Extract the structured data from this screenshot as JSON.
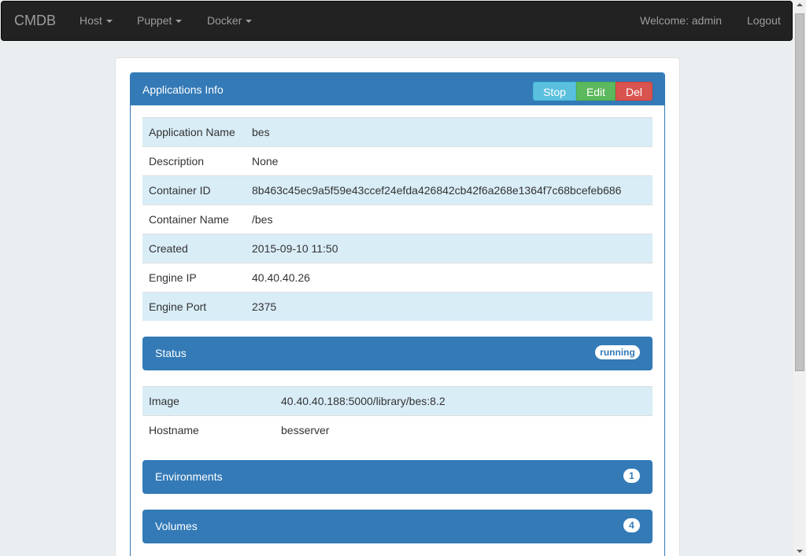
{
  "nav": {
    "brand": "CMDB",
    "menus": [
      "Host",
      "Puppet",
      "Docker"
    ],
    "welcome": "Welcome: admin",
    "logout": "Logout"
  },
  "panel": {
    "title": "Applications Info",
    "buttons": {
      "stop": "Stop",
      "edit": "Edit",
      "del": "Del"
    },
    "rows": [
      {
        "label": "Application Name",
        "value": "bes"
      },
      {
        "label": "Description",
        "value": "None"
      },
      {
        "label": "Container ID",
        "value": "8b463c45ec9a5f59e43ccef24efda426842cb42f6a268e1364f7c68bcefeb686"
      },
      {
        "label": "Container Name",
        "value": "/bes"
      },
      {
        "label": "Created",
        "value": "2015-09-10 11:50"
      },
      {
        "label": "Engine IP",
        "value": "40.40.40.26"
      },
      {
        "label": "Engine Port",
        "value": "2375"
      }
    ]
  },
  "status": {
    "title": "Status",
    "badge": "running",
    "rows": [
      {
        "label": "Image",
        "value": "40.40.40.188:5000/library/bes:8.2"
      },
      {
        "label": "Hostname",
        "value": "besserver"
      }
    ]
  },
  "environments": {
    "title": "Environments",
    "count": "1"
  },
  "volumes": {
    "title": "Volumes",
    "count": "4"
  }
}
